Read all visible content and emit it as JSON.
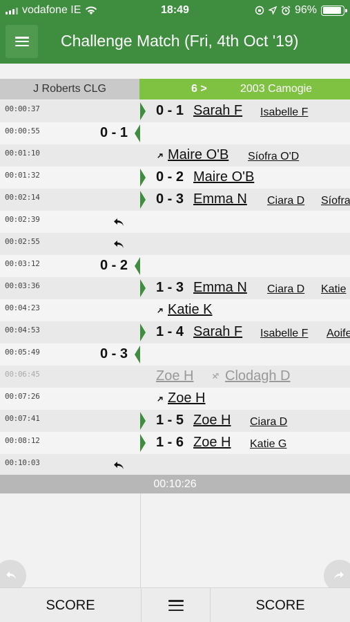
{
  "status_bar": {
    "carrier": "vodafone IE",
    "time": "18:49",
    "battery": "96%",
    "battery_level": 0.96
  },
  "header": {
    "title": "Challenge Match (Fri, 4th Oct '19)",
    "menu_icon": "hamburger-menu-icon"
  },
  "teams": {
    "left_name": "J Roberts CLG",
    "right_score": "6 >",
    "right_name": "2003 Camogie",
    "right_color": "#7fc241",
    "left_color": "#c9c9c9"
  },
  "events": [
    {
      "time": "00:00:37",
      "side": "right",
      "score": "0 - 1",
      "player": "Sarah F",
      "assists": [
        "Isabelle F"
      ]
    },
    {
      "time": "00:00:55",
      "side": "left",
      "score": "0 - 1"
    },
    {
      "time": "00:01:10",
      "side": "right",
      "type": "substitution",
      "player": "Maire O'B",
      "assists": [
        "Síofra O'D"
      ]
    },
    {
      "time": "00:01:32",
      "side": "right",
      "score": "0 - 2",
      "player": "Maire O'B",
      "assists": []
    },
    {
      "time": "00:02:14",
      "side": "right",
      "score": "0 - 3",
      "player": "Emma N",
      "assists": [
        "Ciara D",
        "Síofra"
      ]
    },
    {
      "time": "00:02:39",
      "side": "left",
      "type": "undo"
    },
    {
      "time": "00:02:55",
      "side": "left",
      "type": "undo"
    },
    {
      "time": "00:03:12",
      "side": "left",
      "score": "0 - 2"
    },
    {
      "time": "00:03:36",
      "side": "right",
      "score": "1 - 3",
      "player": "Emma N",
      "assists": [
        "Ciara D",
        "Katie"
      ]
    },
    {
      "time": "00:04:23",
      "side": "right",
      "type": "substitution",
      "player": "Katie K",
      "assists": []
    },
    {
      "time": "00:04:53",
      "side": "right",
      "score": "1 - 4",
      "player": "Sarah F",
      "assists": [
        "Isabelle F",
        "Aoife"
      ]
    },
    {
      "time": "00:05:49",
      "side": "left",
      "score": "0 - 3"
    },
    {
      "time": "00:06:45",
      "side": "right",
      "type": "cancelled",
      "player": "Zoe H",
      "assists": [
        "Clodagh D"
      ]
    },
    {
      "time": "00:07:26",
      "side": "right",
      "type": "substitution",
      "player": "Zoe H",
      "assists": []
    },
    {
      "time": "00:07:41",
      "side": "right",
      "score": "1 - 5",
      "player": "Zoe H",
      "assists": [
        "Ciara D"
      ]
    },
    {
      "time": "00:08:12",
      "side": "right",
      "score": "1 - 6",
      "player": "Zoe H",
      "assists": [
        "Katie G"
      ]
    },
    {
      "time": "00:10:03",
      "side": "left",
      "type": "undo"
    }
  ],
  "end_time": "00:10:26",
  "bottom_bar": {
    "left_label": "SCORE",
    "right_label": "SCORE",
    "middle_icon": "hamburger-menu-icon"
  }
}
